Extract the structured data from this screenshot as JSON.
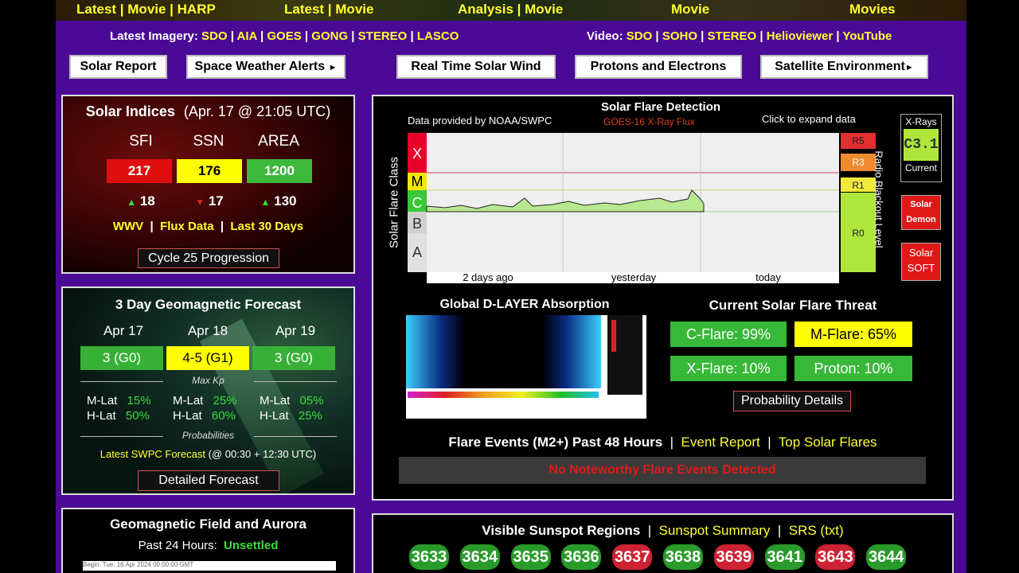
{
  "top_links": [
    "Latest | Movie | HARP",
    "Latest | Movie",
    "Analysis | Movie",
    "Movie",
    "Movies"
  ],
  "nav": {
    "imagery_label": "Latest Imagery:",
    "imagery_links": [
      "SDO",
      "AIA",
      "GOES",
      "GONG",
      "STEREO",
      "LASCO"
    ],
    "video_label": "Video:",
    "video_links": [
      "SDO",
      "SOHO",
      "STEREO",
      "Helioviewer",
      "YouTube"
    ]
  },
  "buttons": [
    "Solar Report",
    "Space Weather Alerts",
    "Real Time Solar Wind",
    "Protons and Electrons",
    "Satellite Environment"
  ],
  "solar_indices": {
    "title": "Solar Indices",
    "timestamp": "(Apr. 17 @ 21:05 UTC)",
    "headers": [
      "SFI",
      "SSN",
      "AREA"
    ],
    "values": [
      "217",
      "176",
      "1200"
    ],
    "changes": [
      "18",
      "17",
      "130"
    ],
    "links": [
      "WWV",
      "Flux Data",
      "Last 30 Days"
    ],
    "cycle_button": "Cycle 25 Progression"
  },
  "forecast": {
    "title": "3 Day Geomagnetic Forecast",
    "days": [
      "Apr 17",
      "Apr 18",
      "Apr 19"
    ],
    "kp": [
      "3 (G0)",
      "4-5 (G1)",
      "3 (G0)"
    ],
    "max_kp_label": "Max Kp",
    "mlat_label": "M-Lat",
    "hlat_label": "H-Lat",
    "mlat": [
      "15%",
      "25%",
      "05%"
    ],
    "hlat": [
      "50%",
      "60%",
      "25%"
    ],
    "prob_label": "Probabilities",
    "swpc_link": "Latest SWPC Forecast",
    "swpc_times": "(@ 00:30 + 12:30 UTC)",
    "detail_button": "Detailed Forecast"
  },
  "geomag": {
    "title": "Geomagnetic Field and Aurora",
    "past_label": "Past 24 Hours:",
    "status": "Unsettled",
    "caption": "Begin: Tue, 16 Apr 2024 00:00:00 GMT"
  },
  "flare_chart": {
    "title": "Solar Flare Detection",
    "provider": "Data provided by NOAA/SWPC",
    "source": "GOES-16 X-Ray Flux",
    "expand": "Click to expand data",
    "ylabel": "Solar Flare Class",
    "classes": [
      "X",
      "M",
      "C",
      "B",
      "A"
    ],
    "xticks": [
      "2 days ago",
      "yesterday",
      "today"
    ],
    "blackout_levels": [
      "R5",
      "R3",
      "R1",
      "R0"
    ],
    "blackout_label": "Radio Blackout Level",
    "xray_label": "X-Rays",
    "xray_value": "C3.1",
    "xray_current": "Current",
    "colors": {
      "x_band": "#e8002a",
      "m_band": "#f0e800",
      "c_band": "#38c838",
      "r5": "#e03030",
      "r3": "#f08a30",
      "r1": "#f2ea3a",
      "r0": "#aee63c"
    }
  },
  "side_buttons": {
    "demon": [
      "Solar",
      "Demon"
    ],
    "soft": [
      "Solar",
      "SOFT"
    ]
  },
  "dlayer": {
    "title": "Global D-LAYER Absorption"
  },
  "threat": {
    "title": "Current Solar Flare Threat",
    "c_flare": "C-Flare: 99%",
    "m_flare": "M-Flare: 65%",
    "x_flare": "X-Flare: 10%",
    "proton": "Proton: 10%",
    "details_button": "Probability Details"
  },
  "flare_events": {
    "title": "Flare Events (M2+) Past 48 Hours",
    "event_report": "Event Report",
    "top_flares": "Top Solar Flares",
    "none_text": "No Noteworthy Flare Events Detected"
  },
  "sunspots": {
    "title": "Visible Sunspot Regions",
    "summary": "Sunspot Summary",
    "srs": "SRS (txt)",
    "regions": [
      "3633",
      "3634",
      "3635",
      "3636",
      "3637",
      "3638",
      "3639",
      "3641",
      "3643",
      "3644"
    ],
    "region_colors": [
      "#2a9a2a",
      "#2a9a2a",
      "#2a9a2a",
      "#2a9a2a",
      "#cc2233",
      "#2a9a2a",
      "#cc2233",
      "#2a9a2a",
      "#cc2233",
      "#2a9a2a"
    ]
  }
}
